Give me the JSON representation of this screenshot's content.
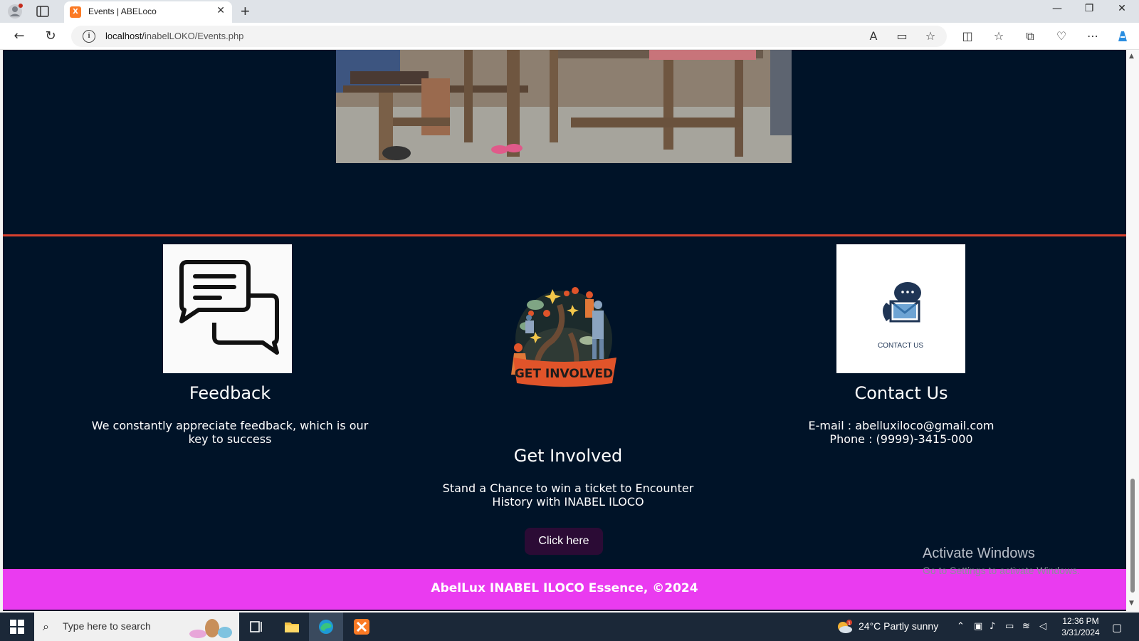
{
  "browser": {
    "tab_title": "Events | ABELoco",
    "tab_favicon": "xampp-icon",
    "url_host": "localhost/",
    "url_path": "inabelLOKO/Events.php",
    "window_controls": [
      "minimize",
      "restore",
      "close"
    ]
  },
  "page": {
    "photo_alt": "weaving-loom-photo",
    "feedback": {
      "title": "Feedback",
      "text": "We constantly appreciate feedback, which is our key to success"
    },
    "get_involved": {
      "badge_text": "GET INVOLVED",
      "title": "Get Involved",
      "text": "Stand a Chance to win a ticket to Encounter History with INABEL ILOCO",
      "button": "Click here"
    },
    "contact": {
      "image_caption": "CONTACT US",
      "title": "Contact Us",
      "email": "E-mail : abelluxiloco@gmail.com",
      "phone": "Phone : (9999)-3415-000"
    },
    "footer": "AbelLux INABEL ILOCO Essence, ©2024"
  },
  "watermark": {
    "line1": "Activate Windows",
    "line2": "Go to Settings to activate Windows."
  },
  "taskbar": {
    "search_placeholder": "Type here to search",
    "weather": "24°C  Partly sunny",
    "weather_badge": "1",
    "time": "12:36 PM",
    "date": "3/31/2024"
  },
  "colors": {
    "page_bg": "#001328",
    "divider": "#d9412e",
    "footer_bg": "#ea3bf0",
    "button_bg": "#2b0b35"
  }
}
